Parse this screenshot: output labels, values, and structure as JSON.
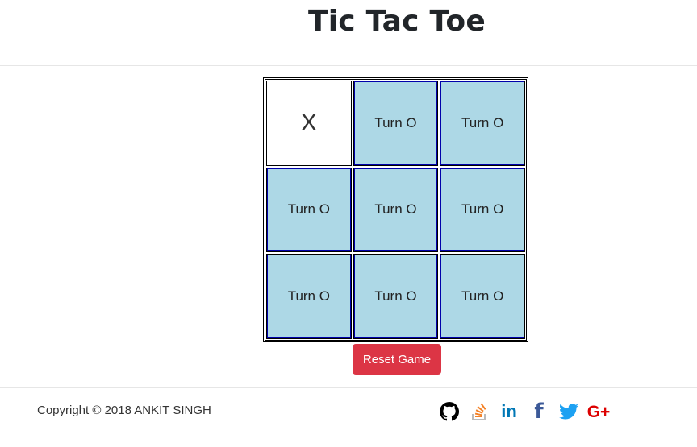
{
  "header": {
    "title": "Tic Tac Toe"
  },
  "board": {
    "cells": [
      {
        "text": "X",
        "state": "filled"
      },
      {
        "text": "Turn O",
        "state": "empty"
      },
      {
        "text": "Turn O",
        "state": "empty"
      },
      {
        "text": "Turn O",
        "state": "empty"
      },
      {
        "text": "Turn O",
        "state": "empty"
      },
      {
        "text": "Turn O",
        "state": "empty"
      },
      {
        "text": "Turn O",
        "state": "empty"
      },
      {
        "text": "Turn O",
        "state": "empty"
      },
      {
        "text": "Turn O",
        "state": "empty"
      }
    ]
  },
  "controls": {
    "reset_label": "Reset Game"
  },
  "footer": {
    "copyright": "Copyright © 2018 ANKIT SINGH",
    "socials": [
      {
        "icon": "github-icon",
        "color": "#000000"
      },
      {
        "icon": "stackoverflow-icon",
        "color": "#f48024"
      },
      {
        "icon": "linkedin-icon",
        "color": "#0077b5",
        "glyph": "in"
      },
      {
        "icon": "facebook-icon",
        "color": "#3b5998",
        "glyph": "f"
      },
      {
        "icon": "twitter-icon",
        "color": "#1da1f2"
      },
      {
        "icon": "google-plus-icon",
        "color": "#dd0000",
        "glyph": "G+"
      }
    ]
  },
  "colors": {
    "cell_empty": "#add8e6",
    "reset_button": "#dc3545"
  }
}
